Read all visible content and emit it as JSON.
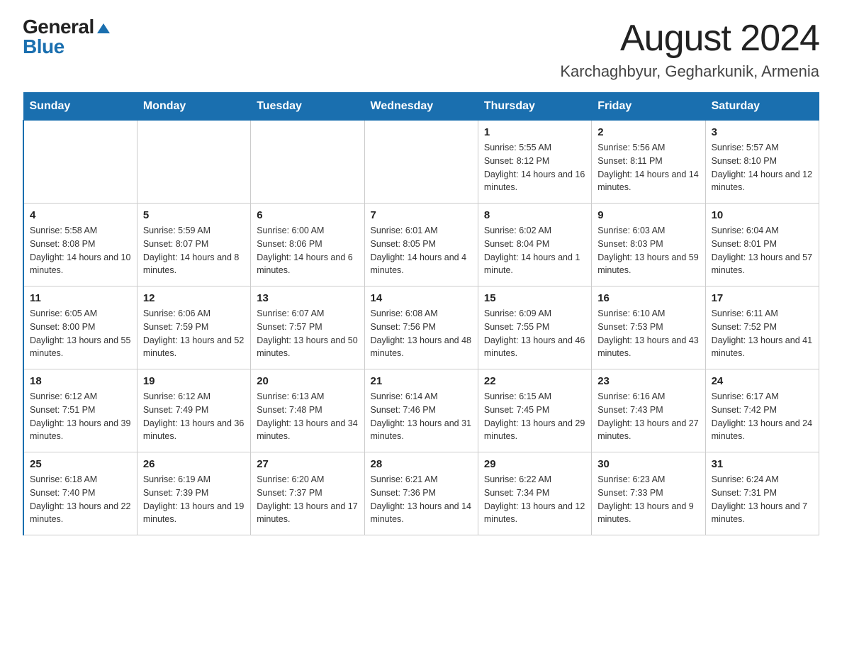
{
  "header": {
    "logo_general": "General",
    "logo_blue": "Blue",
    "month_title": "August 2024",
    "location": "Karchaghbyur, Gegharkunik, Armenia"
  },
  "weekdays": [
    "Sunday",
    "Monday",
    "Tuesday",
    "Wednesday",
    "Thursday",
    "Friday",
    "Saturday"
  ],
  "weeks": [
    {
      "days": [
        {
          "number": "",
          "info": ""
        },
        {
          "number": "",
          "info": ""
        },
        {
          "number": "",
          "info": ""
        },
        {
          "number": "",
          "info": ""
        },
        {
          "number": "1",
          "info": "Sunrise: 5:55 AM\nSunset: 8:12 PM\nDaylight: 14 hours and 16 minutes."
        },
        {
          "number": "2",
          "info": "Sunrise: 5:56 AM\nSunset: 8:11 PM\nDaylight: 14 hours and 14 minutes."
        },
        {
          "number": "3",
          "info": "Sunrise: 5:57 AM\nSunset: 8:10 PM\nDaylight: 14 hours and 12 minutes."
        }
      ]
    },
    {
      "days": [
        {
          "number": "4",
          "info": "Sunrise: 5:58 AM\nSunset: 8:08 PM\nDaylight: 14 hours and 10 minutes."
        },
        {
          "number": "5",
          "info": "Sunrise: 5:59 AM\nSunset: 8:07 PM\nDaylight: 14 hours and 8 minutes."
        },
        {
          "number": "6",
          "info": "Sunrise: 6:00 AM\nSunset: 8:06 PM\nDaylight: 14 hours and 6 minutes."
        },
        {
          "number": "7",
          "info": "Sunrise: 6:01 AM\nSunset: 8:05 PM\nDaylight: 14 hours and 4 minutes."
        },
        {
          "number": "8",
          "info": "Sunrise: 6:02 AM\nSunset: 8:04 PM\nDaylight: 14 hours and 1 minute."
        },
        {
          "number": "9",
          "info": "Sunrise: 6:03 AM\nSunset: 8:03 PM\nDaylight: 13 hours and 59 minutes."
        },
        {
          "number": "10",
          "info": "Sunrise: 6:04 AM\nSunset: 8:01 PM\nDaylight: 13 hours and 57 minutes."
        }
      ]
    },
    {
      "days": [
        {
          "number": "11",
          "info": "Sunrise: 6:05 AM\nSunset: 8:00 PM\nDaylight: 13 hours and 55 minutes."
        },
        {
          "number": "12",
          "info": "Sunrise: 6:06 AM\nSunset: 7:59 PM\nDaylight: 13 hours and 52 minutes."
        },
        {
          "number": "13",
          "info": "Sunrise: 6:07 AM\nSunset: 7:57 PM\nDaylight: 13 hours and 50 minutes."
        },
        {
          "number": "14",
          "info": "Sunrise: 6:08 AM\nSunset: 7:56 PM\nDaylight: 13 hours and 48 minutes."
        },
        {
          "number": "15",
          "info": "Sunrise: 6:09 AM\nSunset: 7:55 PM\nDaylight: 13 hours and 46 minutes."
        },
        {
          "number": "16",
          "info": "Sunrise: 6:10 AM\nSunset: 7:53 PM\nDaylight: 13 hours and 43 minutes."
        },
        {
          "number": "17",
          "info": "Sunrise: 6:11 AM\nSunset: 7:52 PM\nDaylight: 13 hours and 41 minutes."
        }
      ]
    },
    {
      "days": [
        {
          "number": "18",
          "info": "Sunrise: 6:12 AM\nSunset: 7:51 PM\nDaylight: 13 hours and 39 minutes."
        },
        {
          "number": "19",
          "info": "Sunrise: 6:12 AM\nSunset: 7:49 PM\nDaylight: 13 hours and 36 minutes."
        },
        {
          "number": "20",
          "info": "Sunrise: 6:13 AM\nSunset: 7:48 PM\nDaylight: 13 hours and 34 minutes."
        },
        {
          "number": "21",
          "info": "Sunrise: 6:14 AM\nSunset: 7:46 PM\nDaylight: 13 hours and 31 minutes."
        },
        {
          "number": "22",
          "info": "Sunrise: 6:15 AM\nSunset: 7:45 PM\nDaylight: 13 hours and 29 minutes."
        },
        {
          "number": "23",
          "info": "Sunrise: 6:16 AM\nSunset: 7:43 PM\nDaylight: 13 hours and 27 minutes."
        },
        {
          "number": "24",
          "info": "Sunrise: 6:17 AM\nSunset: 7:42 PM\nDaylight: 13 hours and 24 minutes."
        }
      ]
    },
    {
      "days": [
        {
          "number": "25",
          "info": "Sunrise: 6:18 AM\nSunset: 7:40 PM\nDaylight: 13 hours and 22 minutes."
        },
        {
          "number": "26",
          "info": "Sunrise: 6:19 AM\nSunset: 7:39 PM\nDaylight: 13 hours and 19 minutes."
        },
        {
          "number": "27",
          "info": "Sunrise: 6:20 AM\nSunset: 7:37 PM\nDaylight: 13 hours and 17 minutes."
        },
        {
          "number": "28",
          "info": "Sunrise: 6:21 AM\nSunset: 7:36 PM\nDaylight: 13 hours and 14 minutes."
        },
        {
          "number": "29",
          "info": "Sunrise: 6:22 AM\nSunset: 7:34 PM\nDaylight: 13 hours and 12 minutes."
        },
        {
          "number": "30",
          "info": "Sunrise: 6:23 AM\nSunset: 7:33 PM\nDaylight: 13 hours and 9 minutes."
        },
        {
          "number": "31",
          "info": "Sunrise: 6:24 AM\nSunset: 7:31 PM\nDaylight: 13 hours and 7 minutes."
        }
      ]
    }
  ]
}
